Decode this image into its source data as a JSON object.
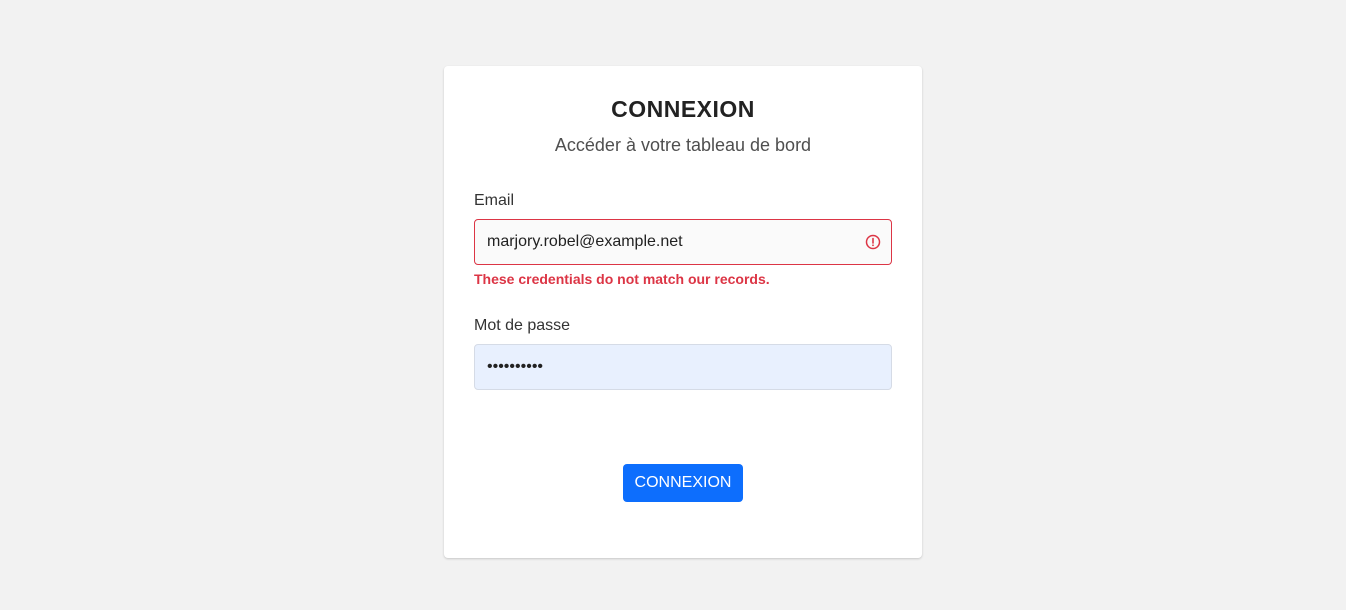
{
  "login": {
    "title": "CONNEXION",
    "subtitle": "Accéder à votre tableau de bord",
    "email": {
      "label": "Email",
      "value": "marjory.robel@example.net",
      "error": "These credentials do not match our records.",
      "icon": "alert-circle-icon"
    },
    "password": {
      "label": "Mot de passe",
      "value": "••••••••••"
    },
    "submit_label": "CONNEXION"
  },
  "colors": {
    "background": "#f2f2f2",
    "card": "#ffffff",
    "error": "#dc3545",
    "primary": "#0d6efd",
    "autofill": "#e8f0fe"
  }
}
